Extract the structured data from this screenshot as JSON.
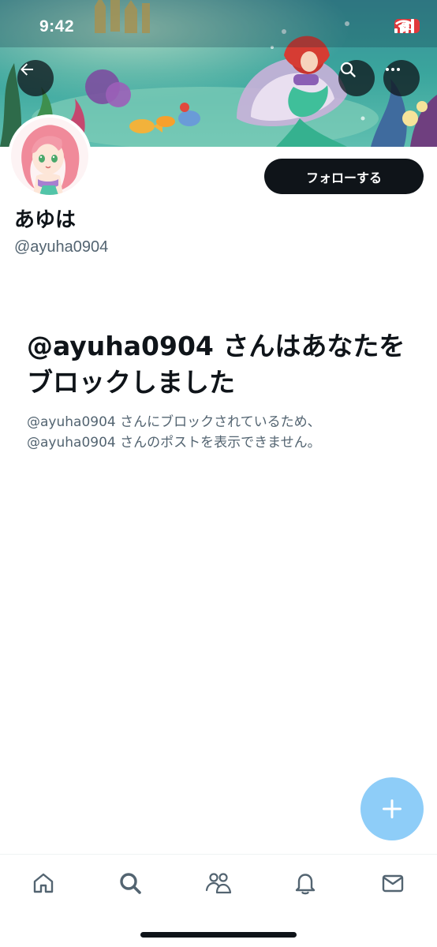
{
  "status_bar": {
    "time": "9:42",
    "battery_level": "20",
    "battery_color": "#e0383b"
  },
  "header": {
    "back_icon": "arrow-left-icon",
    "search_icon": "search-icon",
    "more_icon": "more-horizontal-icon"
  },
  "profile": {
    "display_name": "あゆは",
    "handle": "@ayuha0904",
    "follow_label": "フォローする"
  },
  "blocked": {
    "title": "@ayuha0904 さんはあなたをブロックしました",
    "description_line1": "@ayuha0904 さんにブロックされているため、",
    "description_line2": "@ayuha0904 さんのポストを表示できません。"
  },
  "fab": {
    "icon": "plus-icon",
    "color": "#8ecdf8"
  },
  "bottom_nav": {
    "items": [
      {
        "icon": "home-icon"
      },
      {
        "icon": "search-icon"
      },
      {
        "icon": "communities-icon"
      },
      {
        "icon": "bell-icon"
      },
      {
        "icon": "mail-icon"
      }
    ]
  },
  "colors": {
    "primary_text": "#0f1419",
    "secondary_text": "#536471",
    "accent": "#1d9bf0"
  }
}
